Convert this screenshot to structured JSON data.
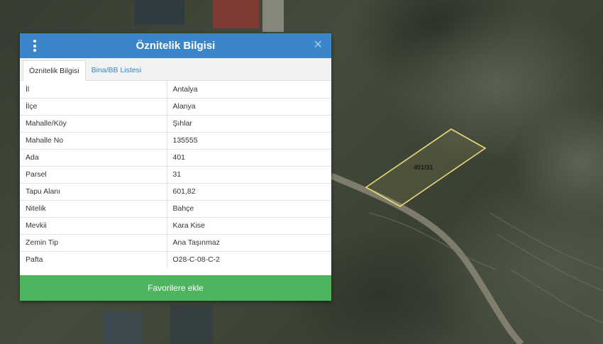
{
  "panel": {
    "title": "Öznitelik Bilgisi",
    "close_symbol": "✕",
    "tabs": [
      {
        "label": "Öznitelik Bilgisi",
        "active": true
      },
      {
        "label": "Bina/BB Listesi",
        "active": false
      }
    ],
    "rows": [
      {
        "key": "İl",
        "value": "Antalya"
      },
      {
        "key": "İlçe",
        "value": "Alanya"
      },
      {
        "key": "Mahalle/Köy",
        "value": "Şıhlar"
      },
      {
        "key": "Mahalle No",
        "value": "135555"
      },
      {
        "key": "Ada",
        "value": "401"
      },
      {
        "key": "Parsel",
        "value": "31"
      },
      {
        "key": "Tapu Alanı",
        "value": "601,82"
      },
      {
        "key": "Nitelik",
        "value": "Bahçe"
      },
      {
        "key": "Mevkii",
        "value": "Kara Kise"
      },
      {
        "key": "Zemin Tip",
        "value": "Ana Taşınmaz"
      },
      {
        "key": "Pafta",
        "value": "O28-C-08-C-2"
      }
    ],
    "favorite_button_label": "Favorilere ekle"
  },
  "map": {
    "parcel_label": "401/31",
    "parcel_outline_color": "#e8d97a"
  },
  "colors": {
    "header": "#3a86c8",
    "button": "#4db35f"
  }
}
